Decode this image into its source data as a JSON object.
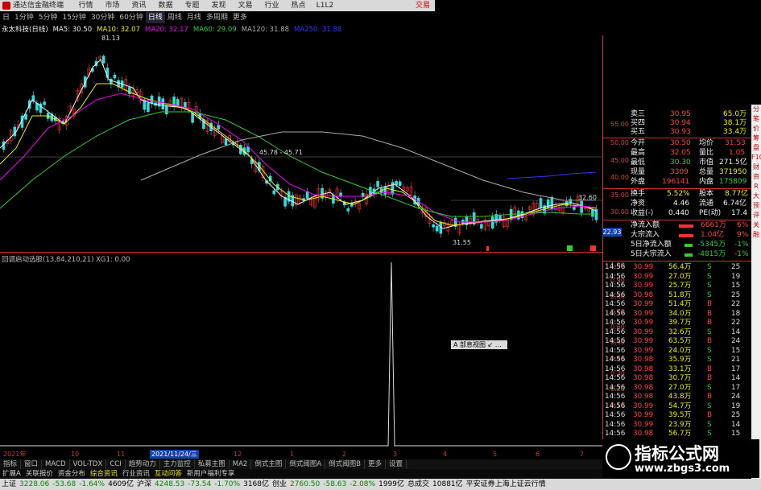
{
  "titlebar": {
    "app_title": "通达信金融终端",
    "menus": [
      "行情",
      "市场",
      "资讯",
      "数据",
      "专题",
      "发现",
      "文易",
      "行业",
      "热点",
      "L1L2"
    ],
    "right": "交易"
  },
  "periodbar": {
    "items": [
      "日",
      "1分钟",
      "5分钟",
      "15分钟",
      "30分钟",
      "60分钟",
      "日线",
      "周线",
      "月线",
      "多周期",
      "更多"
    ],
    "active_index": 6
  },
  "ma_legend": {
    "stock": "永太科技(日线)",
    "ma5": "MA5: 30.50",
    "ma10": "MA10: 32.07",
    "ma20": "MA20: 32.17",
    "ma60": "MA60: 29.09",
    "ma120": "MA120: 31.88",
    "ma250": "MA250: 31.88"
  },
  "chart_labels": {
    "high": "81.13",
    "mid": "45.78 - 45.71",
    "low": "31.55",
    "right_price": "32.60",
    "current": "22.93"
  },
  "price_axis": [
    "55.00",
    "50.00",
    "45.00",
    "40.00",
    "35.00",
    "30.00"
  ],
  "indicator": {
    "title": "回调启动选股(13,84,210,21) XG1: 0.00",
    "axis": [
      "1.00",
      "0.90",
      "0.80",
      "0.70",
      "0.60",
      "0.50",
      "0.40",
      "0.30",
      "0.20",
      "0.10"
    ]
  },
  "popup": "A 部息视图 ↙ …",
  "quote": {
    "rows": [
      {
        "l": "卖三",
        "v": "30.95",
        "r": "65.0万"
      },
      {
        "l": "买四",
        "v": "30.94",
        "r": "38.1万"
      },
      {
        "l": "买五",
        "v": "30.93",
        "r": "33.4万"
      }
    ],
    "stats": [
      {
        "l1": "今开",
        "v1": "30.50",
        "l2": "均价",
        "v2": "31.53"
      },
      {
        "l1": "最高",
        "v1": "32.05",
        "l2": "量比",
        "v2": "1.05"
      },
      {
        "l1": "最低",
        "v1": "30.30",
        "l2": "市值",
        "v2": "271.5亿"
      },
      {
        "l1": "现量",
        "v1": "3309",
        "l2": "总量",
        "v2": "371950"
      },
      {
        "l1": "外盘",
        "v1": "196141",
        "l2": "内盘",
        "v2": "175809"
      }
    ],
    "stats2": [
      {
        "l1": "换手",
        "v1": "5.52%",
        "l2": "股本",
        "v2": "8.77亿"
      },
      {
        "l1": "净资",
        "v1": "4.46",
        "l2": "流通",
        "v2": "6.74亿"
      },
      {
        "l1": "收益(-)",
        "v1": "0.440",
        "l2": "PE(动)",
        "v2": "17.4"
      }
    ],
    "flows": [
      {
        "l": "净流入额",
        "v": "6661万",
        "p": "6%"
      },
      {
        "l": "大宗流入",
        "v": "1.04亿",
        "p": "9%"
      },
      {
        "l": "5日净流入额",
        "v": "-5345万",
        "p": "-1%"
      },
      {
        "l": "5日大宗流入",
        "v": "-4815万",
        "p": "-1%"
      }
    ]
  },
  "ticks": [
    {
      "t": "14:56",
      "p": "30.99",
      "v": "56.4万",
      "s": "S",
      "n": "25"
    },
    {
      "t": "14:56",
      "p": "30.99",
      "v": "27.0万",
      "s": "S",
      "n": "19"
    },
    {
      "t": "14:56",
      "p": "30.99",
      "v": "25.7万",
      "s": "S",
      "n": "15"
    },
    {
      "t": "14:56",
      "p": "30.98",
      "v": "51.8万",
      "s": "S",
      "n": "25"
    },
    {
      "t": "14:56",
      "p": "30.99",
      "v": "51.4万",
      "s": "B",
      "n": "22"
    },
    {
      "t": "14:56",
      "p": "30.99",
      "v": "34.0万",
      "s": "B",
      "n": "18"
    },
    {
      "t": "14:56",
      "p": "30.99",
      "v": "39.7万",
      "s": "B",
      "n": "22"
    },
    {
      "t": "14:56",
      "p": "30.99",
      "v": "32.6万",
      "s": "S",
      "n": "14"
    },
    {
      "t": "14:56",
      "p": "30.99",
      "v": "63.5万",
      "S": "",
      "s": "B",
      "n": "24"
    },
    {
      "t": "14:56",
      "p": "30.99",
      "v": "24.0万",
      "s": "S",
      "n": "15"
    },
    {
      "t": "14:56",
      "p": "30.98",
      "v": "35.9万",
      "s": "S",
      "n": "21"
    },
    {
      "t": "14:56",
      "p": "30.98",
      "v": "33.1万",
      "s": "B",
      "n": "17"
    },
    {
      "t": "14:56",
      "p": "30.98",
      "v": "30.7万",
      "s": "B",
      "n": "14"
    },
    {
      "t": "14:56",
      "p": "30.98",
      "v": "27.0万",
      "s": "S",
      "n": "17"
    },
    {
      "t": "14:56",
      "p": "30.98",
      "v": "43.8万",
      "s": "B",
      "n": "24"
    },
    {
      "t": "14:56",
      "p": "30.99",
      "v": "54.7万",
      "s": "S",
      "n": "19"
    },
    {
      "t": "14:56",
      "p": "30.99",
      "v": "39.5万",
      "s": "B",
      "n": "25"
    },
    {
      "t": "14:56",
      "p": "30.99",
      "v": "23.9万",
      "s": "S",
      "n": "14"
    },
    {
      "t": "14:56",
      "p": "30.98",
      "v": "56.7万",
      "s": "S",
      "n": "15"
    }
  ],
  "datebar": {
    "year": "2021年",
    "m10": "10",
    "m11": "11",
    "sel": "2021/11/24/三",
    "m12": "12",
    "m1": "1",
    "m2": "2",
    "m3": "3",
    "m4": "4",
    "m5": "5",
    "m6": "6",
    "m7": "7"
  },
  "tabs1": [
    "指标",
    "窗口",
    "MACD",
    "VOL-TDX",
    "CCI",
    "趋势动力",
    "主力监控",
    "私募主图",
    "MA2",
    "倒式主图",
    "倒式阈图A",
    "倒式阈图B",
    "更多",
    "设置"
  ],
  "tabs2": [
    "扩展A",
    "关联报价",
    "资金分布",
    "综合资讯",
    "行业资讯",
    "互动问答",
    "新用户福利专享"
  ],
  "status": {
    "a": "上证",
    "a_v": "3228.06",
    "a_c": "-53.68",
    "a_p": "-1.64%",
    "a_vol": "4609亿",
    "b": "沪深",
    "b_v": "4248.53",
    "b_c": "-73.54",
    "b_p": "-1.70%",
    "b_vol": "3168亿",
    "c": "创业",
    "c_v": "2760.50",
    "c_c": "-58.63",
    "c_p": "-2.08%",
    "c_vol": "1999亿",
    "d": "总成交",
    "d_v": "10881亿",
    "e": "平安证券上海上证云行情"
  },
  "watermark": {
    "title": "指标公式网",
    "url": "www.zbgs3.com"
  },
  "scroll_icons": [
    "分",
    "笔",
    "价",
    "筹",
    "盘",
    "F10",
    "财",
    "资",
    "R",
    "大",
    "预",
    "评",
    "关",
    "融"
  ],
  "colors": {
    "up": "#ff3333",
    "down": "#33cc33",
    "ma5": "#eeeeee",
    "ma10": "#eeee00",
    "ma20": "#ee00ee",
    "ma60": "#33cc33",
    "ma120": "#aaaaaa",
    "ma250": "#3333ff"
  }
}
